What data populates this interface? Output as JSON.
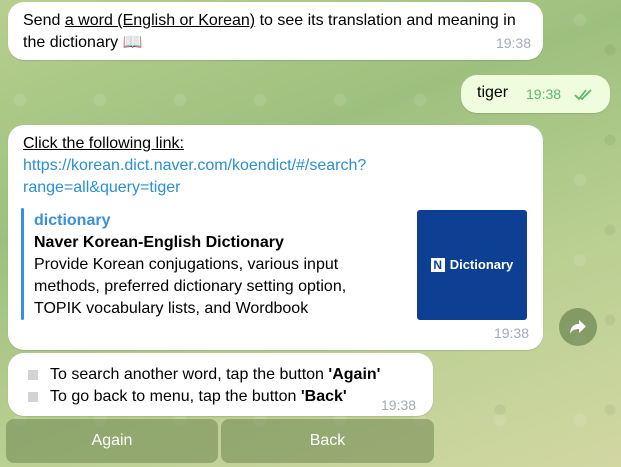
{
  "chat": {
    "message1": {
      "prefix": "Send ",
      "underlined": "a word (English or Korean)",
      "suffix": " to see its translation and meaning in the dictionary 📖",
      "time": "19:38"
    },
    "message2": {
      "text": "tiger",
      "time": "19:38"
    },
    "message3": {
      "line1": "Click the following link:",
      "link": "https://korean.dict.naver.com/koendict/#/search?range=all&query=tiger",
      "preview": {
        "site": "dictionary",
        "title": "Naver Korean-English Dictionary",
        "description": "Provide Korean conjugations, various input methods, preferred dictionary setting option, TOPIK vocabulary lists, and Wordbook",
        "thumb_letter": "N",
        "thumb_text": "Dictionary"
      },
      "time": "19:38"
    },
    "message4": {
      "line1_prefix": "To search another word, tap the button ",
      "line1_bold": "'Again'",
      "line2_prefix": "To go back to menu, tap the button ",
      "line2_bold": "'Back'",
      "time": "19:38"
    }
  },
  "keyboard": {
    "again": "Again",
    "back": "Back"
  },
  "colors": {
    "link": "#2a8fd3",
    "outgoing_bubble": "#effdde",
    "read_ticks": "#5db86a",
    "thumb_bg": "#0d3f93"
  },
  "icons": {
    "share": "share-arrow-icon",
    "read_status": "double-check-icon",
    "book": "book-emoji"
  }
}
